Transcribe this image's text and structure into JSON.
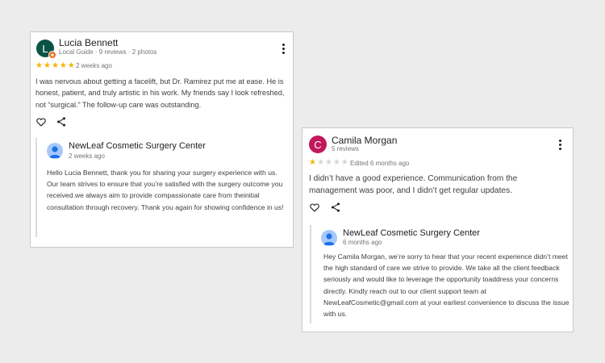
{
  "colors": {
    "page_bg": "#ececec",
    "card_bg": "#ffffff",
    "star_filled": "#f4b400",
    "star_empty": "#d5d5d5",
    "avatar_lucia": "#0b5345",
    "avatar_camila": "#c2185b",
    "local_guide_badge": "#e8711a",
    "owner_avatar": "#a8c7fa"
  },
  "reviews": [
    {
      "reviewer": {
        "initial": "L",
        "name": "Lucia Bennett",
        "meta": "Local Guide · 9 reviews · 2 photos",
        "avatar_icon": "local-guide-badge-icon"
      },
      "rating": 5,
      "date": "2 weeks ago",
      "text": "I was nervous about getting a facelift, but Dr. Ramirez put me at ease. He is honest, patient, and truly artistic in his work. My friends say I look refreshed, not “surgical.” The follow-up care was outstanding.",
      "actions": [
        "like-icon",
        "share-icon"
      ],
      "reply": {
        "owner": "NewLeaf Cosmetic Surgery Center",
        "time": "2 weeks ago",
        "text": "Hello Lucia Bennett, thank you for sharing your surgery experience with us. Our team strives to ensure that you’re satisfied with the surgery outcome you received.we always aim to provide compassionate care from theinitial consultation through recovery. Thank you again for showing confidence in us!"
      }
    },
    {
      "reviewer": {
        "initial": "C",
        "name": "Camila Morgan",
        "meta": "5 reviews"
      },
      "rating": 1,
      "date": "Edited 6 months ago",
      "text": "I didn’t have a good experience. Communication from the management was poor, and I didn’t get regular updates.",
      "actions": [
        "like-icon",
        "share-icon"
      ],
      "reply": {
        "owner": "NewLeaf Cosmetic Surgery Center",
        "time": "6 months ago",
        "text": "Hey Camila Morgan, we’re sorry to hear that your recent experience didn’t meet the high standard of care we strive to provide. We take all the client feedback seriously and would like to leverage the opportunity toaddress your concerns directly. Kindly reach out to our client support team at NewLeafCosmetic@gmail.com at your earliest convenience to discuss the issue with us."
      }
    }
  ]
}
